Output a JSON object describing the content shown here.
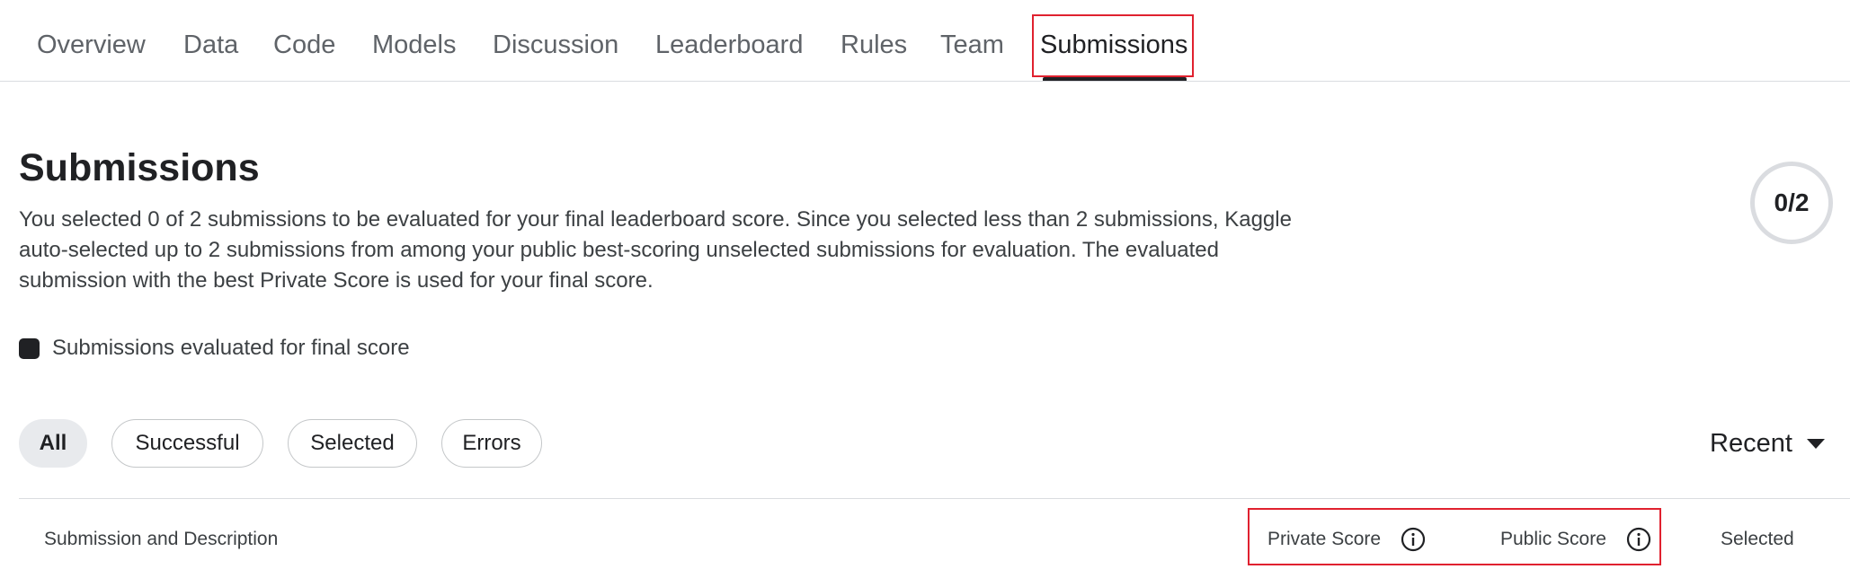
{
  "tabs": [
    {
      "label": "Overview"
    },
    {
      "label": "Data"
    },
    {
      "label": "Code"
    },
    {
      "label": "Models"
    },
    {
      "label": "Discussion"
    },
    {
      "label": "Leaderboard"
    },
    {
      "label": "Rules"
    },
    {
      "label": "Team"
    },
    {
      "label": "Submissions",
      "active": true
    }
  ],
  "page": {
    "title": "Submissions",
    "description": "You selected 0 of 2 submissions to be evaluated for your final leaderboard score. Since you selected less than 2 submissions, Kaggle auto-selected up to 2 submissions from among your public best-scoring unselected submissions for evaluation. The evaluated submission with the best Private Score is used for your final score.",
    "counter": "0/2",
    "legend_label": "Submissions evaluated for final score"
  },
  "filters": [
    {
      "label": "All",
      "selected": true
    },
    {
      "label": "Successful"
    },
    {
      "label": "Selected"
    },
    {
      "label": "Errors"
    }
  ],
  "sort": {
    "label": "Recent",
    "icon": "caret-down-icon"
  },
  "table": {
    "columns": {
      "submission": "Submission and Description",
      "private_score": "Private Score",
      "public_score": "Public Score",
      "selected": "Selected"
    }
  },
  "colors": {
    "highlight": "#e0212f",
    "text": "#202124",
    "muted": "#5f6368",
    "chip_selected": "#e8eaed"
  }
}
